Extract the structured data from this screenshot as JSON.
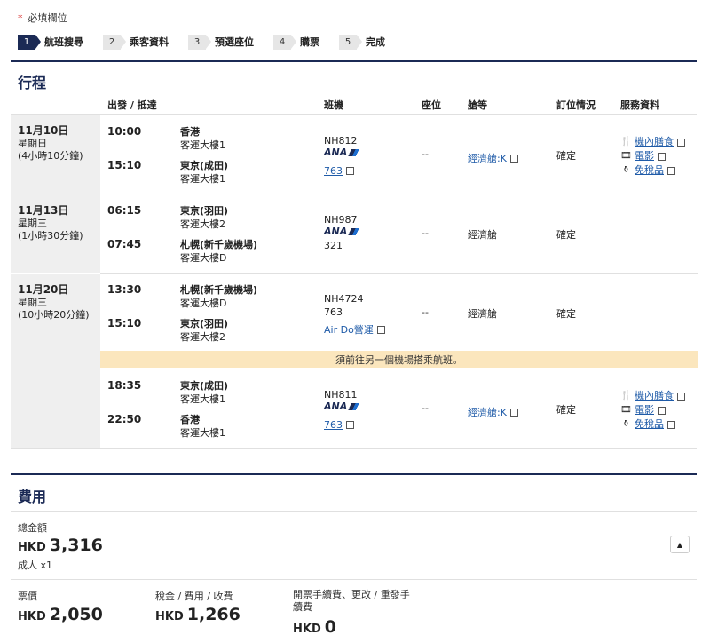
{
  "required_note": "必填欄位",
  "steps": [
    {
      "num": "1",
      "label": "航班搜尋",
      "active": true
    },
    {
      "num": "2",
      "label": "乘客資料",
      "active": false
    },
    {
      "num": "3",
      "label": "預選座位",
      "active": false
    },
    {
      "num": "4",
      "label": "購票",
      "active": false
    },
    {
      "num": "5",
      "label": "完成",
      "active": false
    }
  ],
  "itinerary": {
    "title": "行程",
    "headers": {
      "depart_arrive": "出發 / 抵達",
      "flight": "班機",
      "seat": "座位",
      "cabin": "艙等",
      "status": "訂位情況",
      "services": "服務資料"
    },
    "days": [
      {
        "date": "11月10日",
        "weekday": "星期日",
        "duration": "(4小時10分鐘)"
      },
      {
        "date": "11月13日",
        "weekday": "星期三",
        "duration": "(1小時30分鐘)"
      },
      {
        "date": "11月20日",
        "weekday": "星期三",
        "duration": "(10小時20分鐘)"
      }
    ],
    "segments": [
      {
        "dep_time": "10:00",
        "dep_city": "香港",
        "dep_term": "客運大樓1",
        "arr_time": "15:10",
        "arr_city": "東京(成田)",
        "arr_term": "客運大樓1",
        "flight": "NH812",
        "airline": "ANA",
        "aircraft": "763",
        "seat": "--",
        "cabin": "經濟艙:K",
        "status": "確定",
        "services": [
          "機內膳食",
          "電影",
          "免稅品"
        ]
      },
      {
        "dep_time": "06:15",
        "dep_city": "東京(羽田)",
        "dep_term": "客運大樓2",
        "arr_time": "07:45",
        "arr_city": "札幌(新千歲機場)",
        "arr_term": "客運大樓D",
        "flight": "NH987",
        "airline": "ANA",
        "aircraft": "321",
        "seat": "--",
        "cabin": "經濟艙",
        "status": "確定"
      },
      {
        "dep_time": "13:30",
        "dep_city": "札幌(新千歲機場)",
        "dep_term": "客運大樓D",
        "arr_time": "15:10",
        "arr_city": "東京(羽田)",
        "arr_term": "客運大樓2",
        "flight": "NH4724",
        "aircraft": "763",
        "operated_by": "Air Do營運",
        "seat": "--",
        "cabin": "經濟艙",
        "status": "確定"
      },
      {
        "dep_time": "18:35",
        "dep_city": "東京(成田)",
        "dep_term": "客運大樓1",
        "arr_time": "22:50",
        "arr_city": "香港",
        "arr_term": "客運大樓1",
        "flight": "NH811",
        "airline": "ANA",
        "aircraft": "763",
        "seat": "--",
        "cabin": "經濟艙:K",
        "status": "確定",
        "services": [
          "機內膳食",
          "電影",
          "免稅品"
        ]
      }
    ],
    "notice": "須前往另一個機場搭乘航班。"
  },
  "fees": {
    "title": "費用",
    "total_label": "總金額",
    "total_currency": "HKD",
    "total_value": "3,316",
    "passenger_note": "成人 x1",
    "items": [
      {
        "label": "票價",
        "currency": "HKD",
        "value": "2,050"
      },
      {
        "label": "稅金 / 費用 / 收費",
        "currency": "HKD",
        "value": "1,266"
      },
      {
        "label": "開票手續費、更改 / 重發手續費",
        "currency": "HKD",
        "value": "0"
      }
    ]
  },
  "icons": {
    "meal": "utensils-icon",
    "movie": "film-reel-icon",
    "duty_free": "duty-free-bottle-icon",
    "external": "external-link-icon",
    "collapse": "chevron-up-icon"
  },
  "colors": {
    "brand": "#1b2a55",
    "link": "#1f5ba8",
    "notice_bg": "#fbe6bd",
    "required": "#d9302f"
  }
}
